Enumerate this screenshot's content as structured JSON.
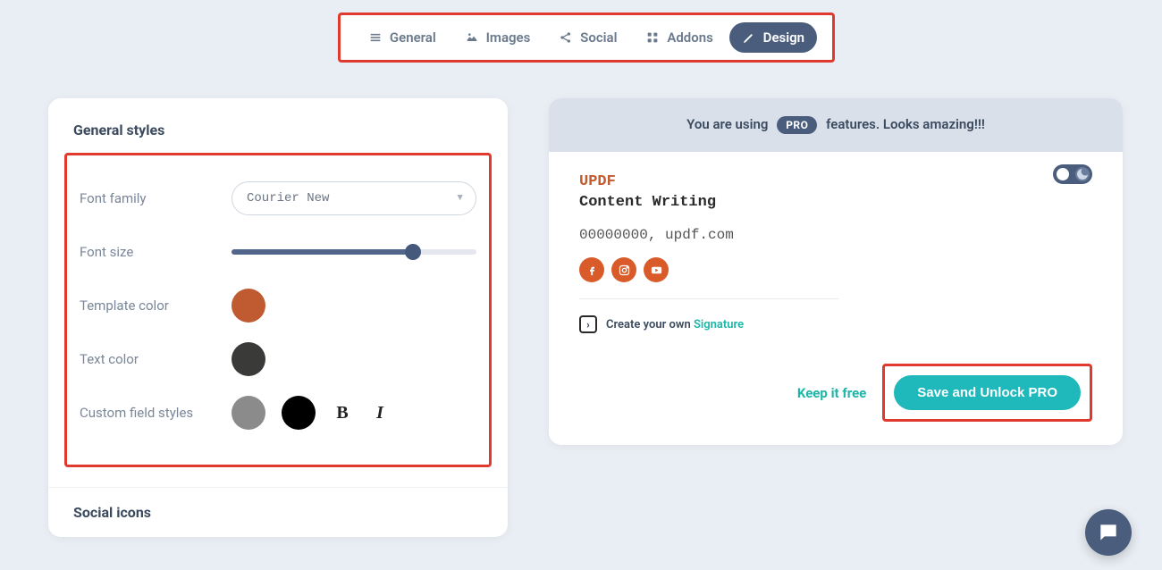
{
  "tabs": {
    "general": "General",
    "images": "Images",
    "social": "Social",
    "addons": "Addons",
    "design": "Design"
  },
  "left": {
    "title": "General styles",
    "font_family_label": "Font family",
    "font_family_value": "Courier New",
    "font_size_label": "Font size",
    "template_color_label": "Template color",
    "text_color_label": "Text color",
    "custom_field_label": "Custom field styles",
    "bold_label": "B",
    "italic_label": "I",
    "social_section": "Social icons"
  },
  "banner": {
    "prefix": "You are using",
    "badge": "PRO",
    "suffix": "features. Looks amazing!!!"
  },
  "signature": {
    "name": "UPDF",
    "title": "Content Writing",
    "phone": "00000000",
    "site": "updf.com",
    "cta_prefix": "Create your own",
    "cta_link": "Signature"
  },
  "actions": {
    "keep": "Keep it free",
    "save": "Save and Unlock PRO"
  },
  "colors": {
    "template": "#c05a30",
    "text": "#3a3a38"
  }
}
